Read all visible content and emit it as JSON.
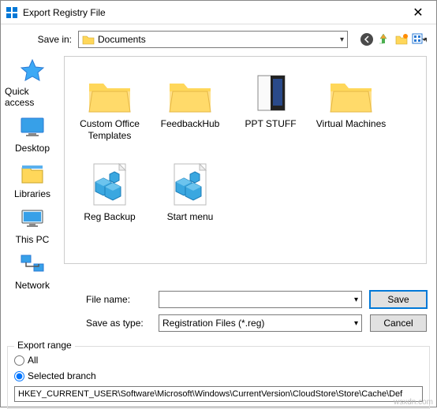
{
  "window": {
    "title": "Export Registry File"
  },
  "savein": {
    "label": "Save in:",
    "value": "Documents"
  },
  "places": [
    {
      "label": "Quick access",
      "icon": "star"
    },
    {
      "label": "Desktop",
      "icon": "desktop"
    },
    {
      "label": "Libraries",
      "icon": "libraries"
    },
    {
      "label": "This PC",
      "icon": "pc"
    },
    {
      "label": "Network",
      "icon": "network"
    }
  ],
  "items": [
    {
      "label": "Custom Office Templates",
      "icon": "folder"
    },
    {
      "label": "FeedbackHub",
      "icon": "folder"
    },
    {
      "label": "PPT STUFF",
      "icon": "book"
    },
    {
      "label": "Virtual Machines",
      "icon": "folder"
    },
    {
      "label": "Reg Backup",
      "icon": "reg"
    },
    {
      "label": "Start menu",
      "icon": "reg"
    }
  ],
  "fields": {
    "filename_label": "File name:",
    "filename_value": "",
    "savetype_label": "Save as type:",
    "savetype_value": "Registration Files (*.reg)",
    "save_btn": "Save",
    "cancel_btn": "Cancel"
  },
  "export": {
    "legend": "Export range",
    "all": "All",
    "selected": "Selected branch",
    "path": "HKEY_CURRENT_USER\\Software\\Microsoft\\Windows\\CurrentVersion\\CloudStore\\Store\\Cache\\Def"
  },
  "watermark": "wsxdn.com"
}
